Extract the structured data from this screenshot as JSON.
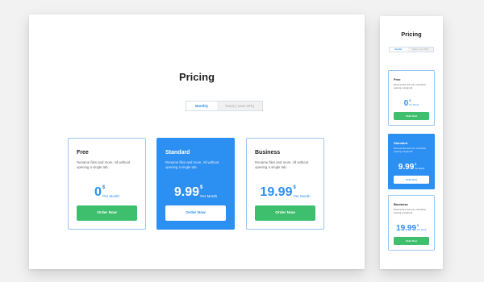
{
  "title": "Pricing",
  "billing_toggle": {
    "monthly_label": "Monthly",
    "yearly_label": "Yearly ( save 20%)",
    "selected": "Monthly"
  },
  "currency_symbol": "$",
  "per_label": "Per Month",
  "button_label": "Order Now",
  "plans": [
    {
      "name": "Free",
      "description": "Rename files and more. All without opening a single tab.",
      "price": "0"
    },
    {
      "name": "Standard",
      "description": "Rename files and more. All without opening a single tab.",
      "price": "9.99"
    },
    {
      "name": "Business",
      "description": "Rename files and more. All without opening a single tab.",
      "price": "19.99"
    }
  ],
  "colors": {
    "accent": "#2c8ff2",
    "button_green": "#3dbf6e",
    "card_border": "#9ac7f3",
    "background": "#f2f2f2"
  }
}
